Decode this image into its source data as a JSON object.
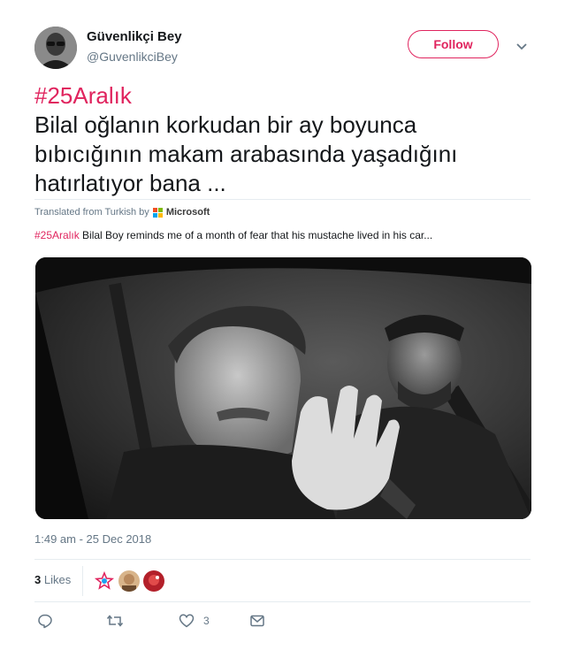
{
  "tweet": {
    "author_name": "Güvenlikçi Bey",
    "author_handle": "@GuvenlikciBey",
    "follow_label": "Follow",
    "hashtag": "#25Aralık",
    "text_line1": "Bilal oğlanın korkudan bir ay boyunca",
    "text_line2": "bıbıcığının makam arabasında yaşadığını",
    "text_line3": "hatırlatıyor bana ...",
    "translated_from": "Translated from Turkish by",
    "translator": "Microsoft",
    "translation_hashtag": "#25Aralık",
    "translation_text": " Bilal Boy reminds me of a month of fear that his mustache lived in his car...",
    "timestamp": "1:49 am - 25 Dec 2018",
    "likes_count": "3",
    "likes_label": "Likes",
    "like_action_count": "3"
  },
  "colors": {
    "accent": "#e0245e",
    "secondary_text": "#657786",
    "divider": "#e6ecf0"
  },
  "icons": [
    "chevron-down-icon",
    "reply-icon",
    "retweet-icon",
    "heart-icon",
    "message-icon",
    "microsoft-logo"
  ]
}
